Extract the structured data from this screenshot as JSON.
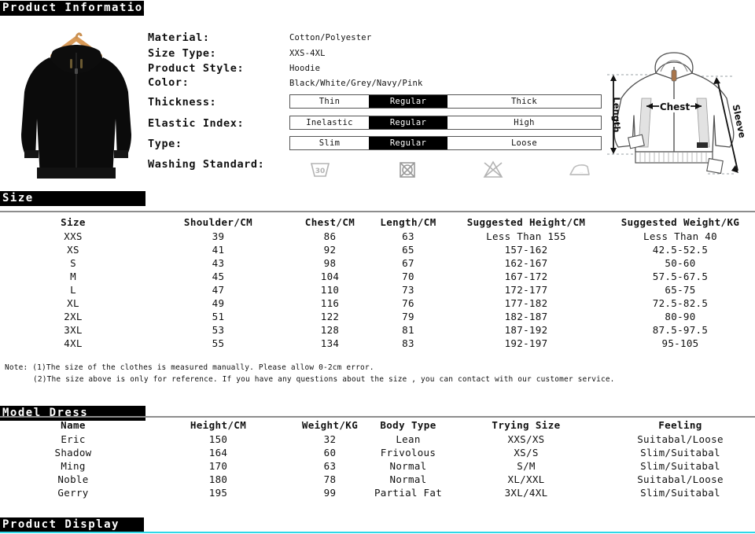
{
  "sections": {
    "product_information": "Product Information",
    "size": "Size",
    "model_dress": "Model Dress",
    "product_display": "Product Display"
  },
  "colors": {
    "banner_bg": "#000000",
    "banner_text": "#ffffff",
    "rule": "#8d8d8d",
    "accent_cyan": "#2fd8e8",
    "selected_segment_bg": "#000000"
  },
  "product": {
    "photo_alt": "black-zip-hoodie-on-wooden-hanger",
    "specs": [
      {
        "label": "Material:",
        "value": "Cotton/Polyester"
      },
      {
        "label": "Size Type:",
        "value": "XXS-4XL"
      },
      {
        "label": "Product Style:",
        "value": "Hoodie"
      },
      {
        "label": "Color:",
        "value": "Black/White/Grey/Navy/Pink"
      }
    ],
    "selectors": [
      {
        "label": "Thickness:",
        "options": [
          "Thin",
          "Regular",
          "Thick"
        ],
        "selected": "Regular",
        "selected_index": 1
      },
      {
        "label": "Elastic Index:",
        "options": [
          "Inelastic",
          "Regular",
          "High"
        ],
        "selected": "Regular",
        "selected_index": 1
      },
      {
        "label": "Type:",
        "options": [
          "Slim",
          "Regular",
          "Loose"
        ],
        "selected": "Regular",
        "selected_index": 1
      }
    ],
    "washing": {
      "label": "Washing Standard:",
      "symbols": [
        {
          "name": "wash-30-degrees-icon",
          "caption": "30"
        },
        {
          "name": "do-not-tumble-dry-icon",
          "caption": ""
        },
        {
          "name": "do-not-bleach-icon",
          "caption": ""
        },
        {
          "name": "iron-icon",
          "caption": ""
        }
      ]
    },
    "diagram": {
      "name": "hoodie-measurement-diagram",
      "labels": {
        "chest": "Chest",
        "length": "Length",
        "sleeve": "Sleeve"
      }
    }
  },
  "size_table": {
    "headers": [
      "Size",
      "Shoulder/CM",
      "Chest/CM",
      "Length/CM",
      "Suggested Height/CM",
      "Suggested Weight/KG"
    ],
    "rows": [
      [
        "XXS",
        "39",
        "86",
        "63",
        "Less Than 155",
        "Less Than 40"
      ],
      [
        "XS",
        "41",
        "92",
        "65",
        "157-162",
        "42.5-52.5"
      ],
      [
        "S",
        "43",
        "98",
        "67",
        "162-167",
        "50-60"
      ],
      [
        "M",
        "45",
        "104",
        "70",
        "167-172",
        "57.5-67.5"
      ],
      [
        "L",
        "47",
        "110",
        "73",
        "172-177",
        "65-75"
      ],
      [
        "XL",
        "49",
        "116",
        "76",
        "177-182",
        "72.5-82.5"
      ],
      [
        "2XL",
        "51",
        "122",
        "79",
        "182-187",
        "80-90"
      ],
      [
        "3XL",
        "53",
        "128",
        "81",
        "187-192",
        "87.5-97.5"
      ],
      [
        "4XL",
        "55",
        "134",
        "83",
        "192-197",
        "95-105"
      ]
    ],
    "note_line_1": "Note: (1)The size of the clothes is measured manually. Please allow 0-2cm error.",
    "note_line_2": "(2)The size above is only for reference. If you have any questions about the size , you can contact with our customer service."
  },
  "model_table": {
    "headers": [
      "Name",
      "Height/CM",
      "Weight/KG",
      "Body Type",
      "Trying Size",
      "Feeling"
    ],
    "rows": [
      [
        "Eric",
        "150",
        "32",
        "Lean",
        "XXS/XS",
        "Suitabal/Loose"
      ],
      [
        "Shadow",
        "164",
        "60",
        "Frivolous",
        "XS/S",
        "Slim/Suitabal"
      ],
      [
        "Ming",
        "170",
        "63",
        "Normal",
        "S/M",
        "Slim/Suitabal"
      ],
      [
        "Noble",
        "180",
        "78",
        "Normal",
        "XL/XXL",
        "Suitabal/Loose"
      ],
      [
        "Gerry",
        "195",
        "99",
        "Partial Fat",
        "3XL/4XL",
        "Slim/Suitabal"
      ]
    ]
  }
}
